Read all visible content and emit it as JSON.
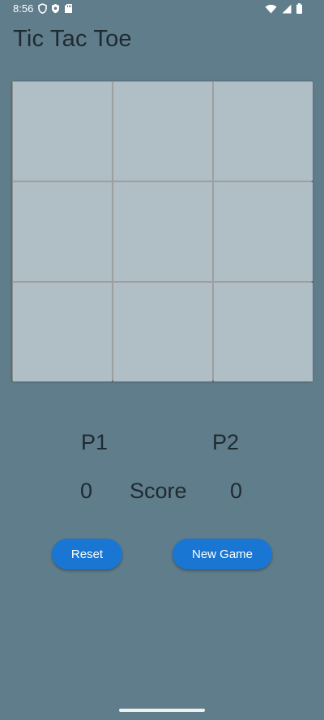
{
  "status_bar": {
    "time": "8:56",
    "left_icons": [
      "shield-outline-icon",
      "shield-filled-icon",
      "sd-card-icon"
    ],
    "right_icons": [
      "wifi-icon",
      "signal-icon",
      "battery-icon"
    ]
  },
  "app": {
    "title": "Tic Tac Toe"
  },
  "board": {
    "cells": [
      "",
      "",
      "",
      "",
      "",
      "",
      "",
      "",
      ""
    ]
  },
  "scoreboard": {
    "p1_label": "P1",
    "p2_label": "P2",
    "p1_score": "0",
    "p2_score": "0",
    "score_label": "Score"
  },
  "buttons": {
    "reset": "Reset",
    "new_game": "New Game"
  },
  "colors": {
    "background": "#607d8b",
    "cell": "#b0bec5",
    "grid_line": "#9e9e9e",
    "button": "#1976d2"
  }
}
